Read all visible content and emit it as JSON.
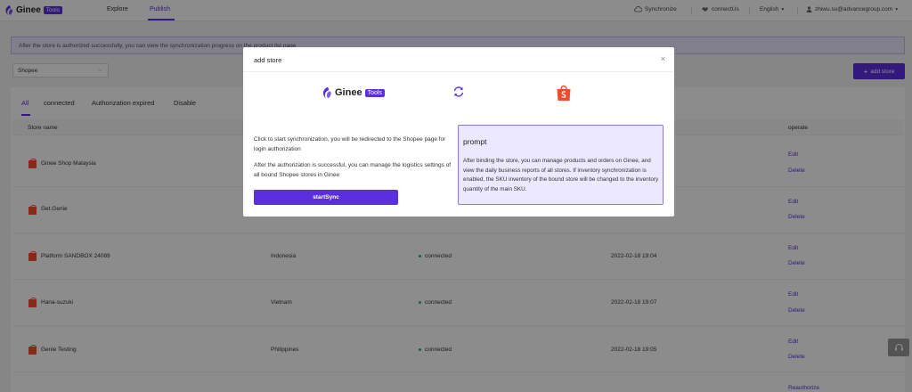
{
  "nav": {
    "logo_text": "Ginee",
    "logo_badge": "Tools",
    "explore": "Explore",
    "publish": "Publish",
    "synchronize": "Synchronize",
    "connect_us": "connectUs",
    "language": "English",
    "user_email": "zhiwu.su@advancegroup.com"
  },
  "banner": "After the store is authorized successfully, you can view the synchronization progress on the product list page",
  "filter": {
    "platform": "Shopee"
  },
  "add_store_label": "add store",
  "tabs": [
    "All",
    "connected",
    "Authorization expired",
    "Disable"
  ],
  "table": {
    "headers": {
      "store_name": "Store name",
      "operate": "operate"
    },
    "rows": [
      {
        "name": "Ginee Shop Malaysia",
        "country": "",
        "status": "",
        "time": "",
        "ops": [
          "Edit",
          "Delete"
        ]
      },
      {
        "name": "Get.Genie",
        "country": "",
        "status": "",
        "time": "",
        "ops": [
          "Edit",
          "Delete"
        ]
      },
      {
        "name": "Platform SANDBOX 24089",
        "country": "Indonesia",
        "status": "connected",
        "time": "2022-02-18 19:04",
        "ops": [
          "Edit",
          "Delete"
        ]
      },
      {
        "name": "Hana-suzuki",
        "country": "Vietnam",
        "status": "connected",
        "time": "2022-02-18 19:07",
        "ops": [
          "Edit",
          "Delete"
        ]
      },
      {
        "name": "Genie Testing",
        "country": "Philippines",
        "status": "connected",
        "time": "2022-02-18 19:05",
        "ops": [
          "Edit",
          "Delete"
        ]
      },
      {
        "name": "",
        "country": "",
        "status": "",
        "time": "",
        "ops": [
          "Reauthorize"
        ]
      }
    ]
  },
  "modal": {
    "title": "add store",
    "logo_text": "Ginee",
    "logo_badge": "Tools",
    "desc1": "Click to start synchronization, you will be redirected to the Shopee page for login authorization",
    "desc2": "After the authorization is successful, you can manage the logistics settings of all bound Shopee stores in Ginee",
    "start_button": "startSync",
    "prompt_title": "prompt",
    "prompt_text": "After binding the store, you can manage products and orders on Ginee, and view the daily business reports of all stores. If inventory synchronization is enabled, the SKU inventory of the bound store will be changed to the inventory quantity of the main SKU."
  },
  "colors": {
    "accent": "#5b2fe0",
    "shopee": "#ee4d2d",
    "connected": "#2db55d"
  }
}
